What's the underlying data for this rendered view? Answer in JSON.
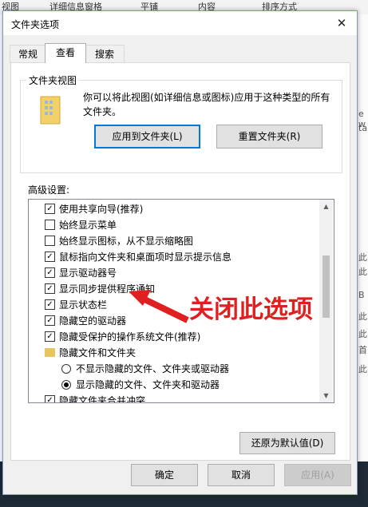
{
  "background": {
    "top_labels": [
      "视图",
      "详细信息窗格",
      "平铺",
      "内容",
      "排序方式"
    ],
    "right_edge_labels": [
      "e w",
      "tar",
      "此",
      "此",
      "B",
      "此",
      "此",
      "首",
      "此"
    ]
  },
  "dialog": {
    "title": "文件夹选项",
    "close_label": "✕",
    "tabs": [
      {
        "label": "常规",
        "active": false
      },
      {
        "label": "查看",
        "active": true
      },
      {
        "label": "搜索",
        "active": false
      }
    ],
    "folder_view": {
      "legend": "文件夹视图",
      "description": "你可以将此视图(如详细信息或图标)应用于这种类型的所有文件夹。",
      "apply_button": "应用到文件夹(L)",
      "reset_button": "重置文件夹(R)"
    },
    "advanced": {
      "label": "高级设置:",
      "items": [
        {
          "type": "checkbox",
          "checked": true,
          "indent": 0,
          "label": "使用共享向导(推荐)"
        },
        {
          "type": "checkbox",
          "checked": false,
          "indent": 0,
          "label": "始终显示菜单"
        },
        {
          "type": "checkbox",
          "checked": false,
          "indent": 0,
          "label": "始终显示图标，从不显示缩略图"
        },
        {
          "type": "checkbox",
          "checked": true,
          "indent": 0,
          "label": "鼠标指向文件夹和桌面项时显示提示信息"
        },
        {
          "type": "checkbox",
          "checked": true,
          "indent": 0,
          "label": "显示驱动器号"
        },
        {
          "type": "checkbox",
          "checked": true,
          "indent": 0,
          "label": "显示同步提供程序通知"
        },
        {
          "type": "checkbox",
          "checked": true,
          "indent": 0,
          "label": "显示状态栏"
        },
        {
          "type": "checkbox",
          "checked": true,
          "indent": 0,
          "label": "隐藏空的驱动器"
        },
        {
          "type": "checkbox",
          "checked": true,
          "indent": 0,
          "label": "隐藏受保护的操作系统文件(推荐)"
        },
        {
          "type": "folder",
          "indent": 0,
          "label": "隐藏文件和文件夹"
        },
        {
          "type": "radio",
          "selected": false,
          "indent": 1,
          "label": "不显示隐藏的文件、文件夹或驱动器"
        },
        {
          "type": "radio",
          "selected": true,
          "indent": 1,
          "label": "显示隐藏的文件、文件夹和驱动器"
        },
        {
          "type": "checkbox",
          "checked": true,
          "indent": 0,
          "label": "隐藏文件夹合并冲突"
        }
      ],
      "scroll_up": "▲",
      "scroll_down": "▼",
      "restore_button": "还原为默认值(D)"
    },
    "annotation": "关闭此选项",
    "footer": {
      "ok": "确定",
      "cancel": "取消",
      "apply": "应用(A)"
    },
    "colors": {
      "annotation": "#e02020",
      "accent": "#0078d7"
    }
  }
}
